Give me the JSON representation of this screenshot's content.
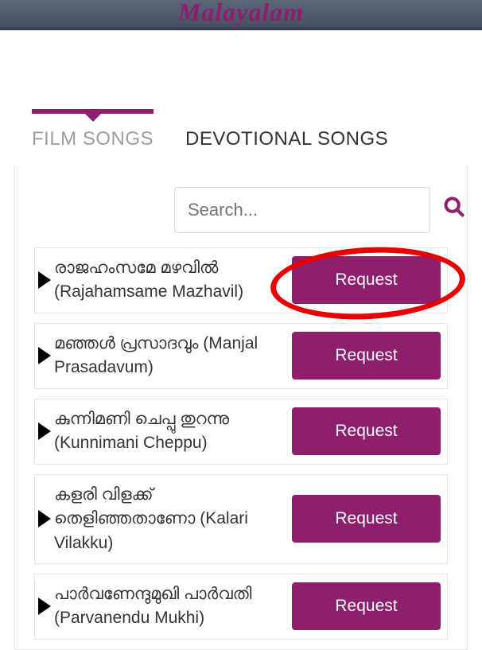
{
  "header": {
    "title": "Malayalam"
  },
  "tabs": {
    "film": "FILM SONGS",
    "devotional": "DEVOTIONAL SONGS"
  },
  "search": {
    "placeholder": "Search..."
  },
  "request_label": "Request",
  "songs": [
    {
      "title": "രാജഹംസമേ മഴവിൽ (Rajahamsame Mazhavil)"
    },
    {
      "title": "മഞ്ഞൾ പ്രസാദവും (Manjal Prasadavum)"
    },
    {
      "title": "കുന്നിമണി ചെപ്പു തുറന്നു (Kunnimani Cheppu)"
    },
    {
      "title": "കളരി വിളക്ക് തെളിഞ്ഞതാണോ (Kalari Vilakku)"
    },
    {
      "title": "പാർവണേന്ദുമുഖി പാർവതി (Parvanendu Mukhi)"
    }
  ]
}
